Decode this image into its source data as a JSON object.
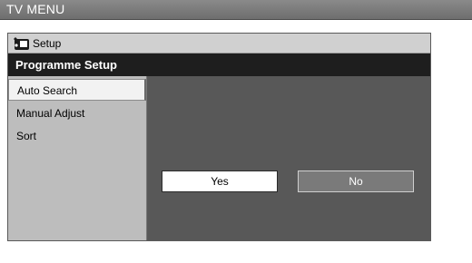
{
  "window": {
    "title": "TV MENU"
  },
  "menu": {
    "setup_label": "Setup",
    "setup_icon": "wrench-tv-icon",
    "section_title": "Programme Setup",
    "items": [
      {
        "label": "Auto Search",
        "selected": true
      },
      {
        "label": "Manual Adjust",
        "selected": false
      },
      {
        "label": "Sort",
        "selected": false
      }
    ]
  },
  "dialog": {
    "yes_label": "Yes",
    "no_label": "No",
    "focused": "Yes"
  },
  "colors": {
    "title_bar": "#7a7a7a",
    "section_header": "#1e1e1e",
    "sidebar": "#bdbdbd",
    "content_panel": "#585858",
    "selected_item": "#f2f2f2"
  }
}
